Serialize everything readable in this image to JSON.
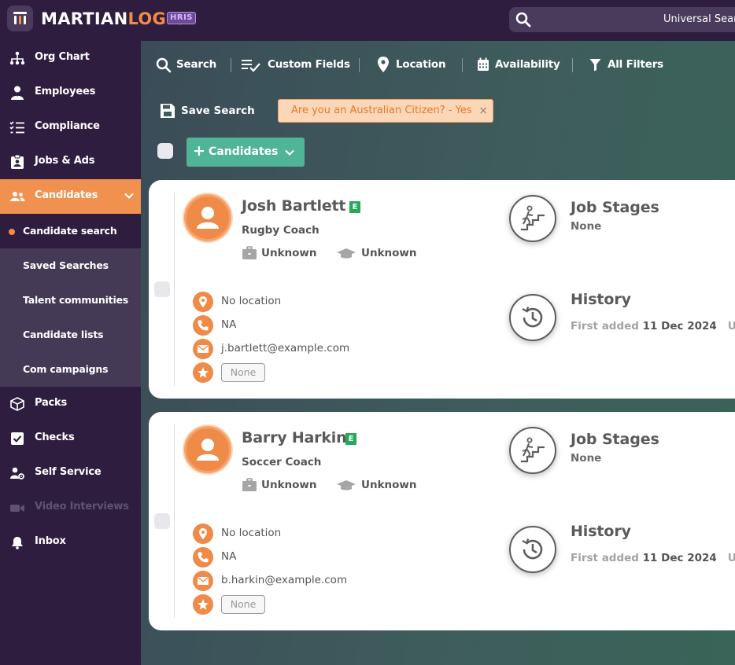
{
  "topbar": {
    "brand_part1": "MARTIAN",
    "brand_part2": "LOGIC",
    "brand_badge": "HRIS",
    "search_placeholder": "Universal Search"
  },
  "sidebar": {
    "items": [
      {
        "label": "Org Chart",
        "icon": "org-chart-icon"
      },
      {
        "label": "Employees",
        "icon": "employee-icon"
      },
      {
        "label": "Compliance",
        "icon": "checklist-icon"
      },
      {
        "label": "Jobs & Ads",
        "icon": "badge-icon"
      },
      {
        "label": "Candidates",
        "icon": "users-icon",
        "active": true
      },
      {
        "label": "Packs",
        "icon": "box-icon"
      },
      {
        "label": "Checks",
        "icon": "checkbox-icon"
      },
      {
        "label": "Self Service",
        "icon": "user-gear-icon"
      },
      {
        "label": "Video Interviews",
        "icon": "video-icon",
        "disabled": true
      },
      {
        "label": "Inbox",
        "icon": "bell-icon"
      }
    ],
    "sub_items": [
      {
        "label": "Candidate search",
        "current": true
      },
      {
        "label": "Saved Searches"
      },
      {
        "label": "Talent communities"
      },
      {
        "label": "Candidate lists"
      },
      {
        "label": "Com campaigns"
      }
    ]
  },
  "toolbar": {
    "search": "Search",
    "custom_fields": "Custom Fields",
    "location": "Location",
    "availability": "Availability",
    "all_filters": "All Filters",
    "save_search": "Save Search",
    "active_filter": "Are you an Australian Citizen? - Yes",
    "remove_filter": "×",
    "candidates_button": "Candidates",
    "plus": "+"
  },
  "candidates": [
    {
      "name": "Josh Bartlett",
      "badge": "E",
      "title": "Rugby Coach",
      "work": "Unknown",
      "education": "Unknown",
      "location": "No location",
      "phone": "NA",
      "email": "j.bartlett@example.com",
      "rating": "None",
      "job_stages_title": "Job Stages",
      "job_stages_value": "None",
      "history_title": "History",
      "first_added_label": "First added ",
      "first_added_date": "11 Dec 2024",
      "updated_label": "Upda"
    },
    {
      "name": "Barry Harkin",
      "badge": "E",
      "title": "Soccer Coach",
      "work": "Unknown",
      "education": "Unknown",
      "location": "No location",
      "phone": "NA",
      "email": "b.harkin@example.com",
      "rating": "None",
      "job_stages_title": "Job Stages",
      "job_stages_value": "None",
      "history_title": "History",
      "first_added_label": "First added ",
      "first_added_date": "11 Dec 2024",
      "updated_label": "Upda"
    }
  ],
  "colors": {
    "sidebar_bg": "#2e1d3f",
    "accent_orange": "#f08a48",
    "candidates_button": "#50b597",
    "badge_green": "#28a85a"
  }
}
